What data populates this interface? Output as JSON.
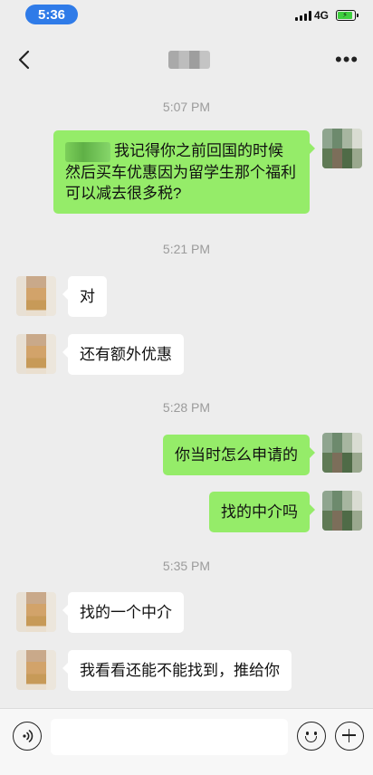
{
  "status_bar": {
    "time": "5:36",
    "network": "4G",
    "battery_level": 0.9,
    "battery_charging": true,
    "battery_color": "#3fcf3f"
  },
  "nav": {
    "back_icon": "chevron-left-icon",
    "more_icon": "more-dots-icon"
  },
  "messages": {
    "ts1": "5:07 PM",
    "m1": "我记得你之前回国的时候然后买车优惠因为留学生那个福利可以减去很多税?",
    "ts2": "5:21 PM",
    "m2": "对",
    "m3": "还有额外优惠",
    "ts3": "5:28 PM",
    "m4": "你当时怎么申请的",
    "m5": "找的中介吗",
    "ts4": "5:35 PM",
    "m6": "找的一个中介",
    "m7": "我看看还能不能找到，推给你"
  },
  "colors": {
    "self_bubble": "#95ec69",
    "other_bubble": "#ffffff",
    "background": "#ededed"
  },
  "input_bar": {
    "value": "",
    "voice_icon": "voice-icon",
    "emoji_icon": "emoji-icon",
    "plus_icon": "plus-icon"
  }
}
